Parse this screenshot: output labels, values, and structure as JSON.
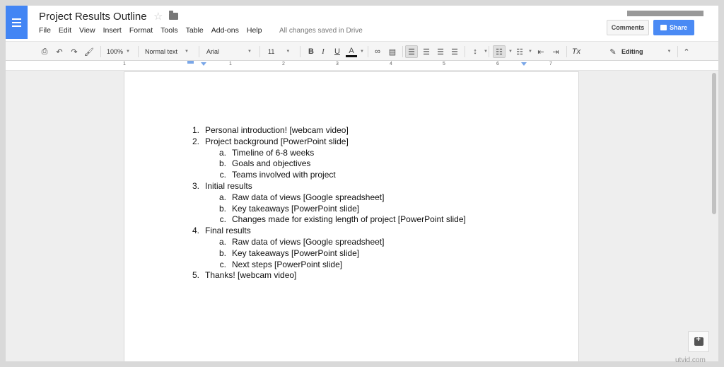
{
  "doc": {
    "title": "Project Results Outline",
    "saved_status": "All changes saved in Drive"
  },
  "menu": [
    "File",
    "Edit",
    "View",
    "Insert",
    "Format",
    "Tools",
    "Table",
    "Add-ons",
    "Help"
  ],
  "header": {
    "comments_label": "Comments",
    "share_label": "Share"
  },
  "toolbar": {
    "zoom": "100%",
    "style": "Normal text",
    "font": "Arial",
    "font_size": "11",
    "bold": "B",
    "italic": "I",
    "underline": "U",
    "text_color": "A",
    "mode": "Editing"
  },
  "ruler": [
    "1",
    "1",
    "2",
    "3",
    "4",
    "5",
    "6",
    "7"
  ],
  "outline": [
    {
      "num": "1.",
      "text": "Personal introduction! [webcam video]",
      "level": 1
    },
    {
      "num": "2.",
      "text": "Project background [PowerPoint slide]",
      "level": 1
    },
    {
      "num": "a.",
      "text": "Timeline of 6-8 weeks",
      "level": 2
    },
    {
      "num": "b.",
      "text": "Goals and objectives",
      "level": 2
    },
    {
      "num": "c.",
      "text": "Teams involved with project",
      "level": 2
    },
    {
      "num": "3.",
      "text": "Initial results",
      "level": 1
    },
    {
      "num": "a.",
      "text": "Raw data of views [Google spreadsheet]",
      "level": 2
    },
    {
      "num": "b.",
      "text": "Key takeaways [PowerPoint slide]",
      "level": 2
    },
    {
      "num": "c.",
      "text": "Changes made for existing length of project [PowerPoint slide]",
      "level": 2
    },
    {
      "num": "4.",
      "text": "Final results",
      "level": 1
    },
    {
      "num": "a.",
      "text": "Raw data of views [Google spreadsheet]",
      "level": 2
    },
    {
      "num": "b.",
      "text": "Key takeaways [PowerPoint slide]",
      "level": 2
    },
    {
      "num": "c.",
      "text": "Next steps [PowerPoint slide]",
      "level": 2
    },
    {
      "num": "5.",
      "text": "Thanks! [webcam video]",
      "level": 1
    }
  ],
  "watermark": "utvid.com",
  "colors": {
    "brand": "#4285f4",
    "share": "#4a8af4"
  },
  "icons": [
    "docs-logo-icon",
    "star-icon",
    "folder-icon",
    "print-icon",
    "undo-icon",
    "redo-icon",
    "paint-format-icon",
    "link-icon",
    "comment-icon",
    "align-left-icon",
    "align-center-icon",
    "align-right-icon",
    "justify-icon",
    "line-spacing-icon",
    "numbered-list-icon",
    "bulleted-list-icon",
    "decrease-indent-icon",
    "increase-indent-icon",
    "clear-formatting-icon",
    "pencil-icon",
    "collapse-icon",
    "explore-icon"
  ]
}
